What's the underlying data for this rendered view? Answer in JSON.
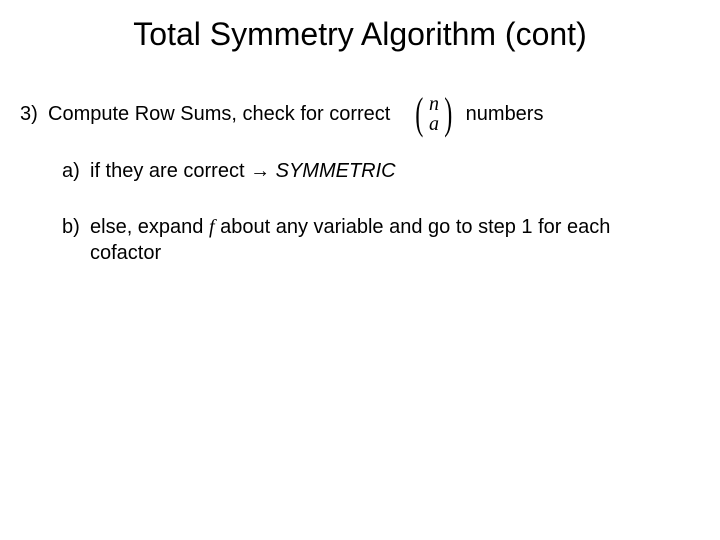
{
  "title": "Total Symmetry Algorithm (cont)",
  "item3": {
    "marker": "3)",
    "text_before_binom": "Compute Row Sums, check for correct",
    "binom_top": "n",
    "binom_bottom": "a",
    "text_after_binom": "numbers"
  },
  "sub_a": {
    "marker": "a)",
    "text_before_arrow": "if they are correct ",
    "arrow": "→",
    "symmetric": " SYMMETRIC"
  },
  "sub_b": {
    "marker": "b)",
    "prefix": "else, expand ",
    "f": "f",
    "suffix": " about any variable and go to step 1 for each cofactor"
  }
}
